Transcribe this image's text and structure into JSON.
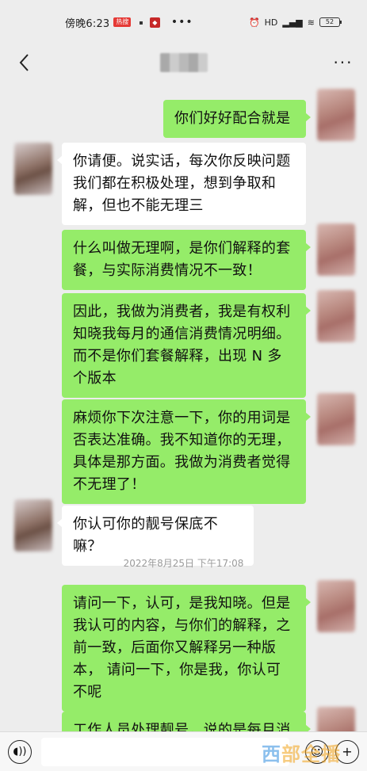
{
  "status_bar": {
    "time": "傍晚6:23",
    "badge": "热搜",
    "battery": "52",
    "signal": "HD"
  },
  "nav": {
    "back_icon": "chevron-left-icon",
    "more_icon": "more-icon",
    "more_glyph": "···"
  },
  "messages": [
    {
      "side": "sent",
      "text": "你们好好配合就是"
    },
    {
      "side": "recv",
      "text": "你请便。说实话，每次你反映问题\n我们都在积极处理，想到争取和\n解，但也不能无理三"
    },
    {
      "side": "sent",
      "text": "什么叫做无理啊，是你们解释的套\n餐，与实际消费情况不一致！"
    },
    {
      "side": "sent",
      "text": "因此，我做为消费者，我是有权利\n知晓我每月的通信消费情况明细。\n而不是你们套餐解释，出现 N 多\n个版本"
    },
    {
      "side": "sent",
      "text": "麻烦你下次注意一下，你的用词是\n否表达准确。我不知道你的无理，\n具体是那方面。我做为消费者觉得\n不无理了！"
    },
    {
      "side": "recv",
      "text": "你认可你的靓号保底不嘛？"
    },
    {
      "side": "sent",
      "text": "请问一下，认可，是我知晓。但是\n我认可的内容，与你们的解释，之\n前一致，后面你又解释另一种版\n本，  请问一下，你是我，你认可\n不呢"
    },
    {
      "side": "sent",
      "text": "工作人员处理靓号，说的是每月消"
    }
  ],
  "timestamp": "2022年8月25日  下午17:08",
  "watermark": {
    "part1": "西",
    "part2": "部全播"
  }
}
